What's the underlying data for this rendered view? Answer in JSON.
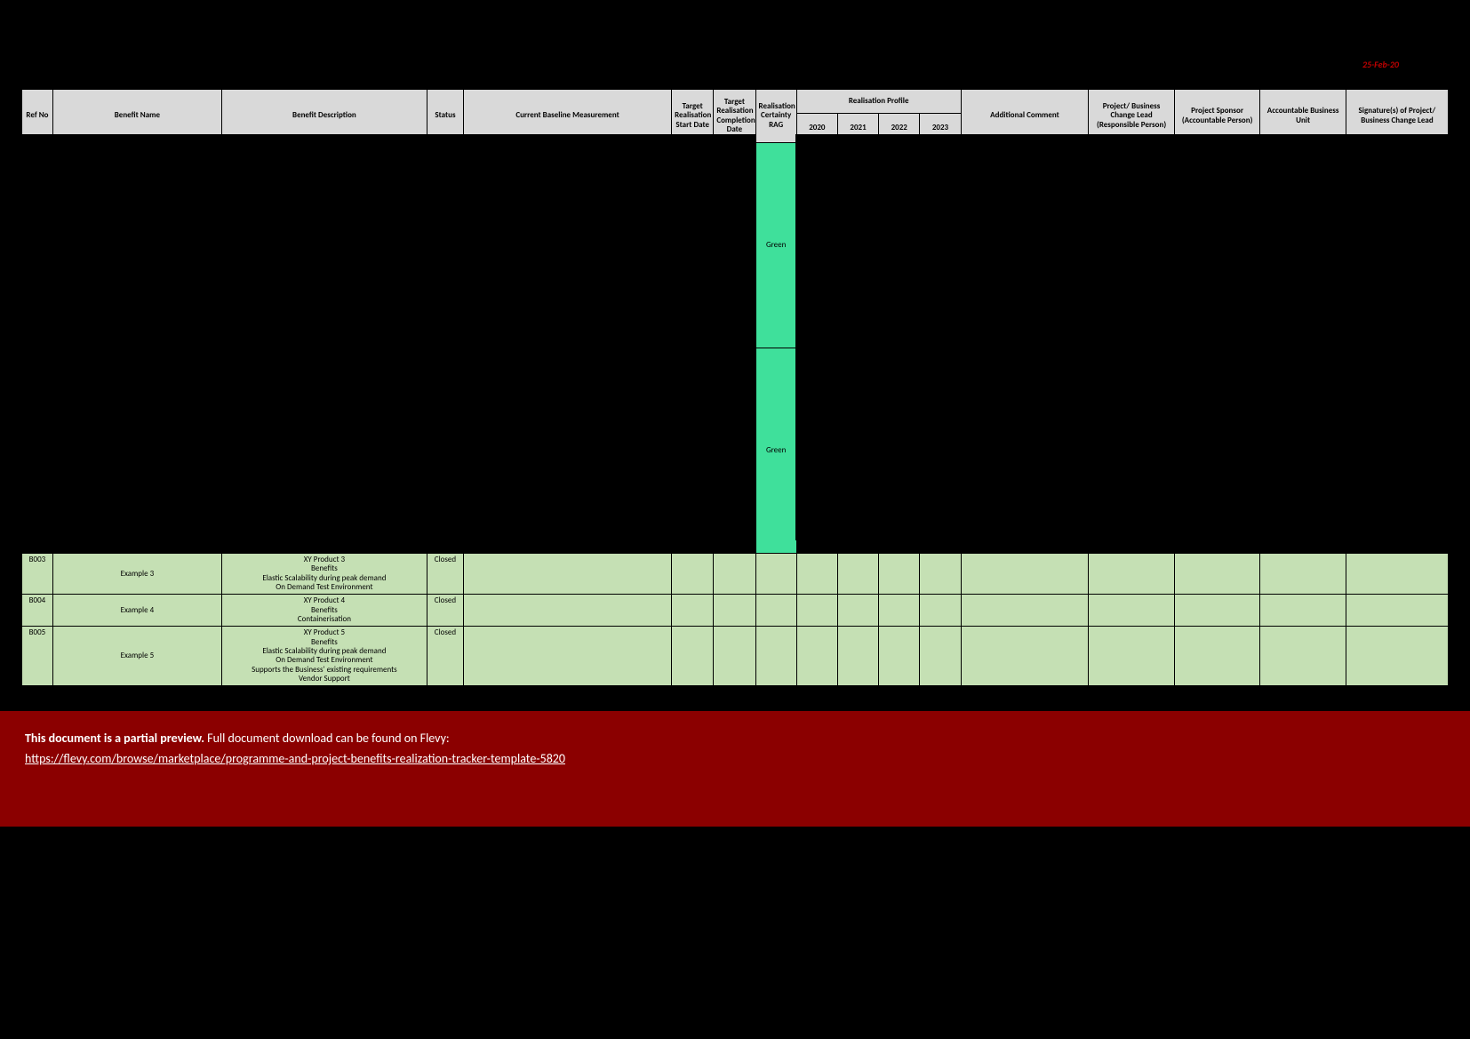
{
  "header_date": "25-Feb-20",
  "headers": {
    "ref": "Ref No",
    "name": "Benefit Name",
    "desc": "Benefit Description",
    "status": "Status",
    "baseline": "Current Baseline Measurement",
    "start": "Target Realisation Start Date",
    "end": "Target Realisation Completion Date",
    "rag": "Realisation Certainty RAG",
    "profile": "Realisation Profile",
    "y2020": "2020",
    "y2021": "2021",
    "y2022": "2022",
    "y2023": "2023",
    "comment": "Additional Comment",
    "lead": "Project/ Business Change Lead (Responsible Person)",
    "sponsor": "Project Sponsor (Accountable Person)",
    "unit": "Accountable Business Unit",
    "sign": "Signature(s) of Project/ Business Change Lead"
  },
  "rows": [
    {
      "ref": "",
      "name": "",
      "desc": "",
      "status": "",
      "rag": "Green"
    },
    {
      "ref": "",
      "name": "",
      "desc": "",
      "status": "",
      "rag": "Green"
    },
    {
      "ref": "B003",
      "name": "Example 3",
      "desc": "XY Product 3\nBenefits\nElastic Scalability during peak demand\nOn Demand Test Environment",
      "status": "Closed",
      "rag": ""
    },
    {
      "ref": "B004",
      "name": "Example 4",
      "desc": "XY Product 4\nBenefits\nContainerisation",
      "status": "Closed",
      "rag": ""
    },
    {
      "ref": "B005",
      "name": "Example 5",
      "desc": "XY Product 5\nBenefits\nElastic Scalability during peak demand\nOn Demand Test Environment\nSupports the Business' existing requirements\nVendor Support",
      "status": "Closed",
      "rag": ""
    }
  ],
  "banner": {
    "bold": "This document is a partial preview.",
    "rest": "  Full document download can be found on Flevy:",
    "link_text": "https://flevy.com/browse/marketplace/programme-and-project-benefits-realization-tracker-template-5820",
    "link_href": "https://flevy.com/browse/marketplace/programme-and-project-benefits-realization-tracker-template-5820"
  }
}
